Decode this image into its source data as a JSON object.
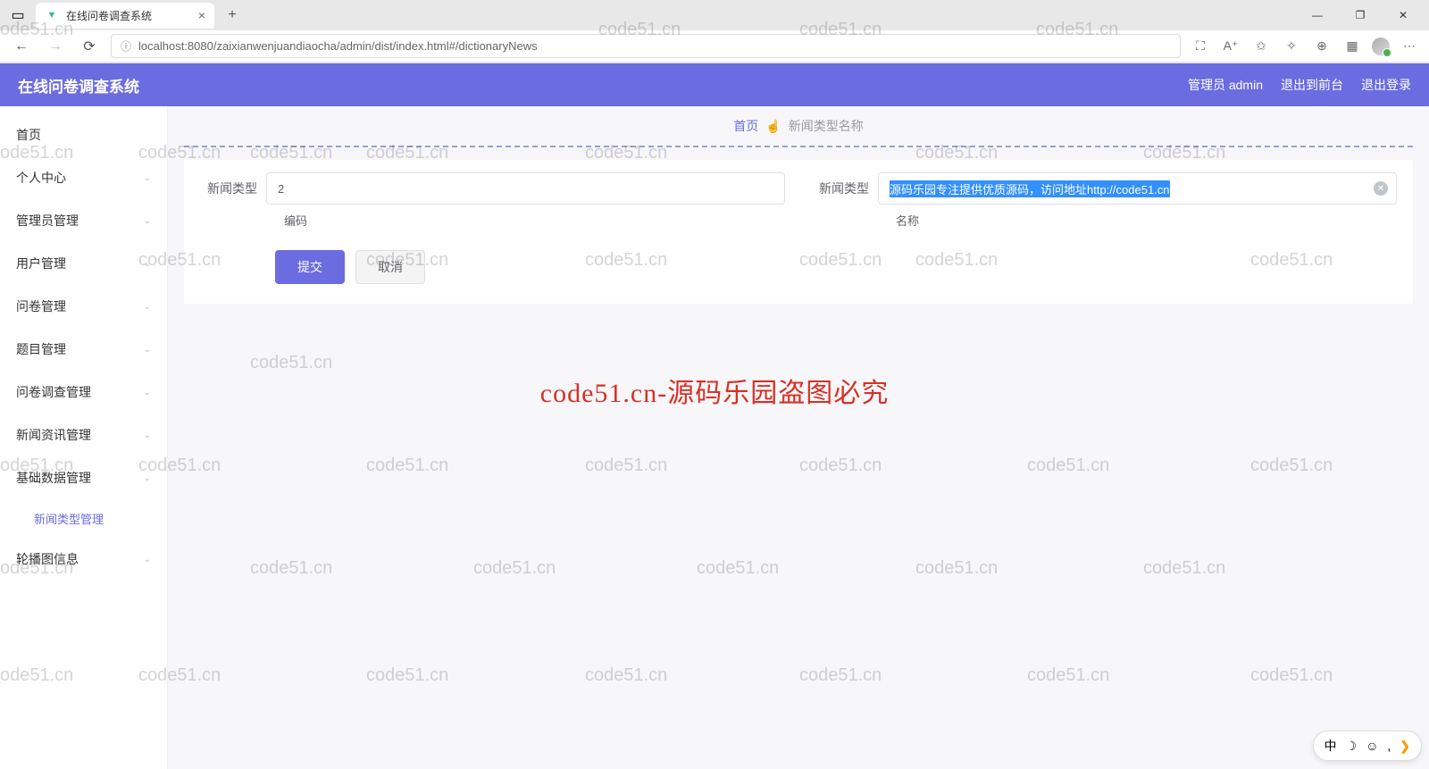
{
  "browser": {
    "tab_title": "在线问卷调查系统",
    "url": "localhost:8080/zaixianwenjuandiaocha/admin/dist/index.html#/dictionaryNews",
    "new_tab": "+",
    "close": "×",
    "minimize": "—",
    "maximize": "❐",
    "win_close": "✕",
    "back": "←",
    "forward": "→",
    "reload": "⟳",
    "lock": "ⓘ",
    "more": "⋯"
  },
  "header": {
    "title": "在线问卷调查系统",
    "user": "管理员 admin",
    "exit_front": "退出到前台",
    "logout": "退出登录"
  },
  "sidebar": {
    "items": [
      {
        "label": "首页",
        "expandable": false
      },
      {
        "label": "个人中心",
        "expandable": true
      },
      {
        "label": "管理员管理",
        "expandable": true
      },
      {
        "label": "用户管理",
        "expandable": true
      },
      {
        "label": "问卷管理",
        "expandable": true
      },
      {
        "label": "题目管理",
        "expandable": true
      },
      {
        "label": "问卷调查管理",
        "expandable": true
      },
      {
        "label": "新闻资讯管理",
        "expandable": true
      },
      {
        "label": "基础数据管理",
        "expandable": true
      },
      {
        "label": "轮播图信息",
        "expandable": true
      }
    ],
    "active_sub": "新闻类型管理"
  },
  "breadcrumb": {
    "home": "首页",
    "hand": "☝",
    "current": "新闻类型名称"
  },
  "form": {
    "code_label": "新闻类型",
    "code_sublabel": "编码",
    "code_value": "2",
    "name_label": "新闻类型",
    "name_sublabel": "名称",
    "name_value": "源码乐园专注提供优质源码，访问地址http://code51.cn",
    "submit": "提交",
    "cancel": "取消"
  },
  "watermark": {
    "text": "code51.cn",
    "center": "code51.cn-源码乐园盗图必究"
  },
  "ime": {
    "lang": "中",
    "moon": "☽",
    "smile": "☺",
    "comma": ",",
    "arrow": "❯"
  }
}
